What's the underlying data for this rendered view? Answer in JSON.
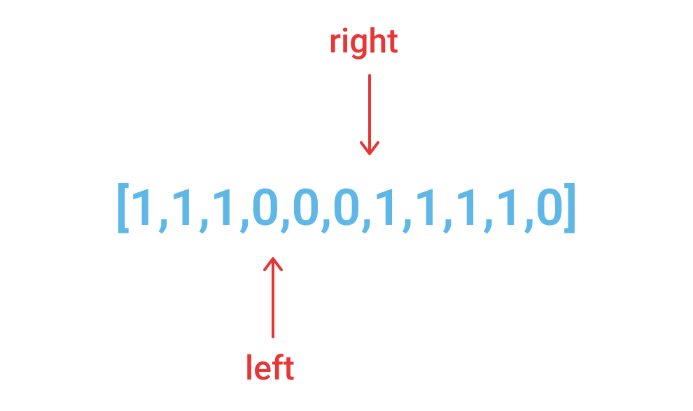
{
  "labels": {
    "top": "right",
    "bottom": "left"
  },
  "array": {
    "values": [
      1,
      1,
      1,
      0,
      0,
      0,
      1,
      1,
      1,
      1,
      0
    ],
    "left_index": 4,
    "right_index": 6
  },
  "colors": {
    "accent_text": "#e83535",
    "array_text": "#5fb7e8"
  }
}
